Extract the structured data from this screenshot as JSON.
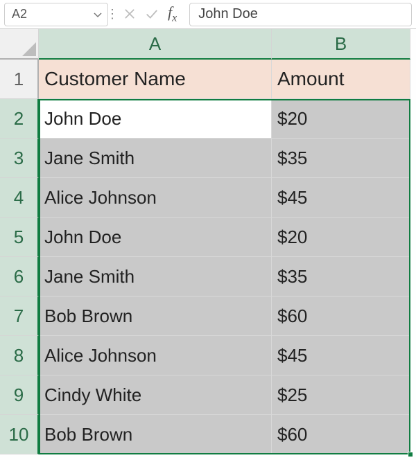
{
  "formula_bar": {
    "active_cell_ref": "A2",
    "formula_value": "John Doe"
  },
  "columns": [
    "A",
    "B"
  ],
  "row_numbers": [
    1,
    2,
    3,
    4,
    5,
    6,
    7,
    8,
    9,
    10
  ],
  "headers": {
    "col_a": "Customer Name",
    "col_b": "Amount"
  },
  "rows": [
    {
      "name": "John Doe",
      "amount": "$20"
    },
    {
      "name": "Jane Smith",
      "amount": "$35"
    },
    {
      "name": "Alice Johnson",
      "amount": "$45"
    },
    {
      "name": "John Doe",
      "amount": "$20"
    },
    {
      "name": "Jane Smith",
      "amount": "$35"
    },
    {
      "name": "Bob Brown",
      "amount": "$60"
    },
    {
      "name": "Alice Johnson",
      "amount": "$45"
    },
    {
      "name": "Cindy White",
      "amount": "$25"
    },
    {
      "name": "Bob Brown",
      "amount": "$60"
    }
  ],
  "selection": {
    "active_cell": "A2",
    "range": "A2:B10"
  },
  "colors": {
    "accent": "#107c41",
    "header_fill": "#f6e0d4"
  }
}
